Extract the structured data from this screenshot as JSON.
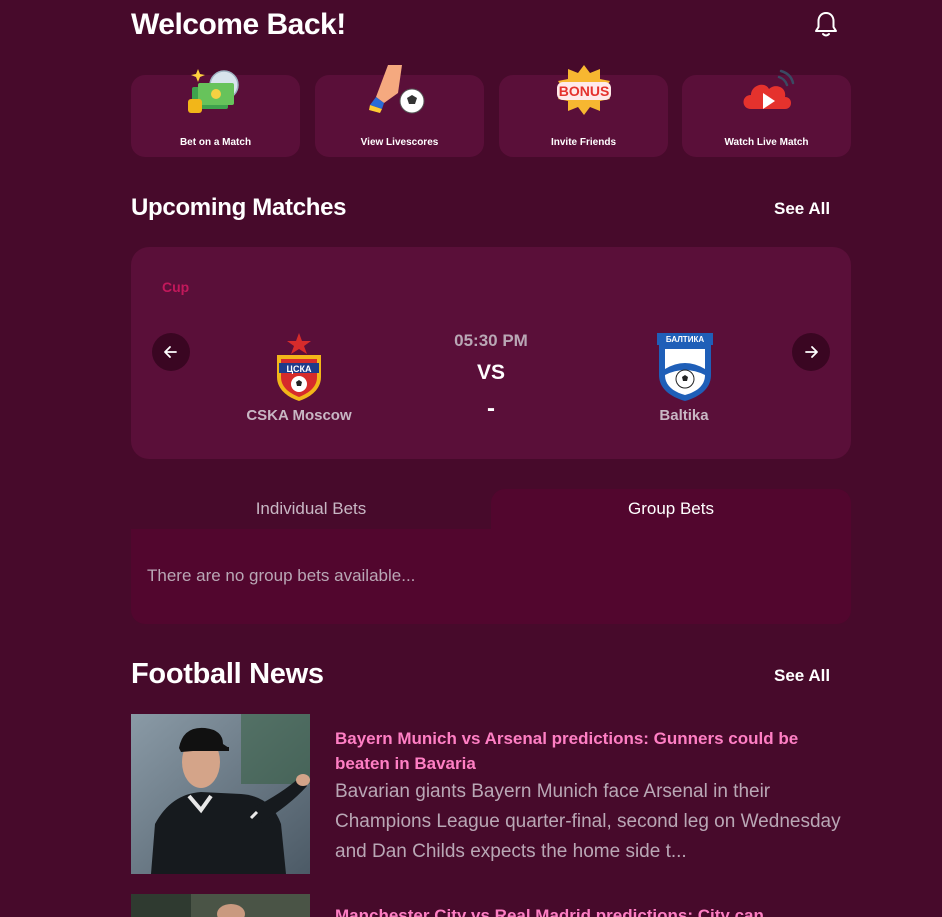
{
  "header": {
    "title": "Welcome Back!",
    "notification_icon": "bell-icon"
  },
  "quick_actions": [
    {
      "label": "Bet on a Match",
      "icon": "money-bet-icon"
    },
    {
      "label": "View Livescores",
      "icon": "kick-ball-icon"
    },
    {
      "label": "Invite Friends",
      "icon": "bonus-badge-icon"
    },
    {
      "label": "Watch Live Match",
      "icon": "live-stream-cloud-icon"
    }
  ],
  "upcoming": {
    "title": "Upcoming Matches",
    "see_all": "See All",
    "match": {
      "competition": "Cup",
      "time": "05:30 PM",
      "vs": "VS",
      "score": "-",
      "home_team": "CSKA Moscow",
      "away_team": "Baltika"
    }
  },
  "bets": {
    "tabs": [
      "Individual Bets",
      "Group Bets"
    ],
    "active_tab": "Group Bets",
    "empty_message": "There are no group bets available..."
  },
  "news": {
    "title": "Football News",
    "see_all": "See All",
    "items": [
      {
        "title": "Bayern Munich vs Arsenal predictions: Gunners could be beaten in Bavaria",
        "description": "Bavarian giants Bayern Munich face Arsenal in their Champions League quarter-final, second leg on Wednesday and Dan Childs expects the home side t..."
      },
      {
        "title": "Manchester City vs Real Madrid predictions: City can",
        "description": ""
      }
    ]
  },
  "colors": {
    "background": "#470a2b",
    "card": "#5a0f39",
    "accent_pink": "#ff7fc4",
    "cup_label": "#c2185b",
    "muted_text": "#b9a7b5"
  }
}
